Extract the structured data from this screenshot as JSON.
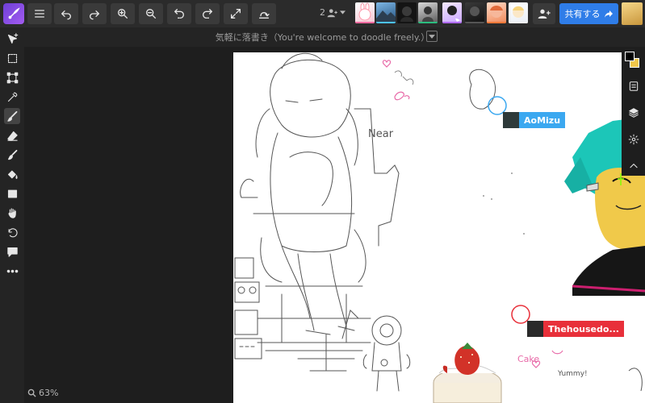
{
  "colors": {
    "accent_share": "#2f7de8",
    "topbar": "#2b2b2b",
    "canvas_bg": "#ffffff",
    "cursor_aomizu": "#3ba8f0",
    "cursor_thehouse": "#e8303a"
  },
  "header": {
    "buttons": [
      "menu-icon",
      "undo-icon",
      "redo-icon",
      "zoom-in-icon",
      "zoom-out-icon",
      "rotate-left-icon",
      "rotate-right-icon",
      "fullscreen-icon",
      "flip-icon"
    ],
    "user_count": "2",
    "share_label": "共有する",
    "avatars": [
      {
        "bar": "#ff6aa0"
      },
      {
        "bar": "#4cc3ff"
      },
      {
        "bar": "#2b2b2b"
      },
      {
        "bar": "#2bbd7e"
      },
      {
        "bar": "#b06bff"
      },
      {
        "bar": "#555555"
      },
      {
        "bar": "#ff7a3a"
      },
      {
        "bar": "#f0f0f0"
      }
    ]
  },
  "document": {
    "title": "気軽に落書き（You're welcome to doodle freely.）"
  },
  "tools": [
    "move",
    "select",
    "transform",
    "eyedropper",
    "brush",
    "eraser",
    "smudge",
    "fill",
    "shape",
    "hand",
    "rotate",
    "comment",
    "more"
  ],
  "status": {
    "zoom": "63%"
  },
  "cursors": [
    {
      "name": "AoMizu"
    },
    {
      "name": "Thehousedo..."
    }
  ],
  "canvas_text": {
    "near": "Near",
    "cake": "Cake",
    "yummy": "Yummy!"
  }
}
